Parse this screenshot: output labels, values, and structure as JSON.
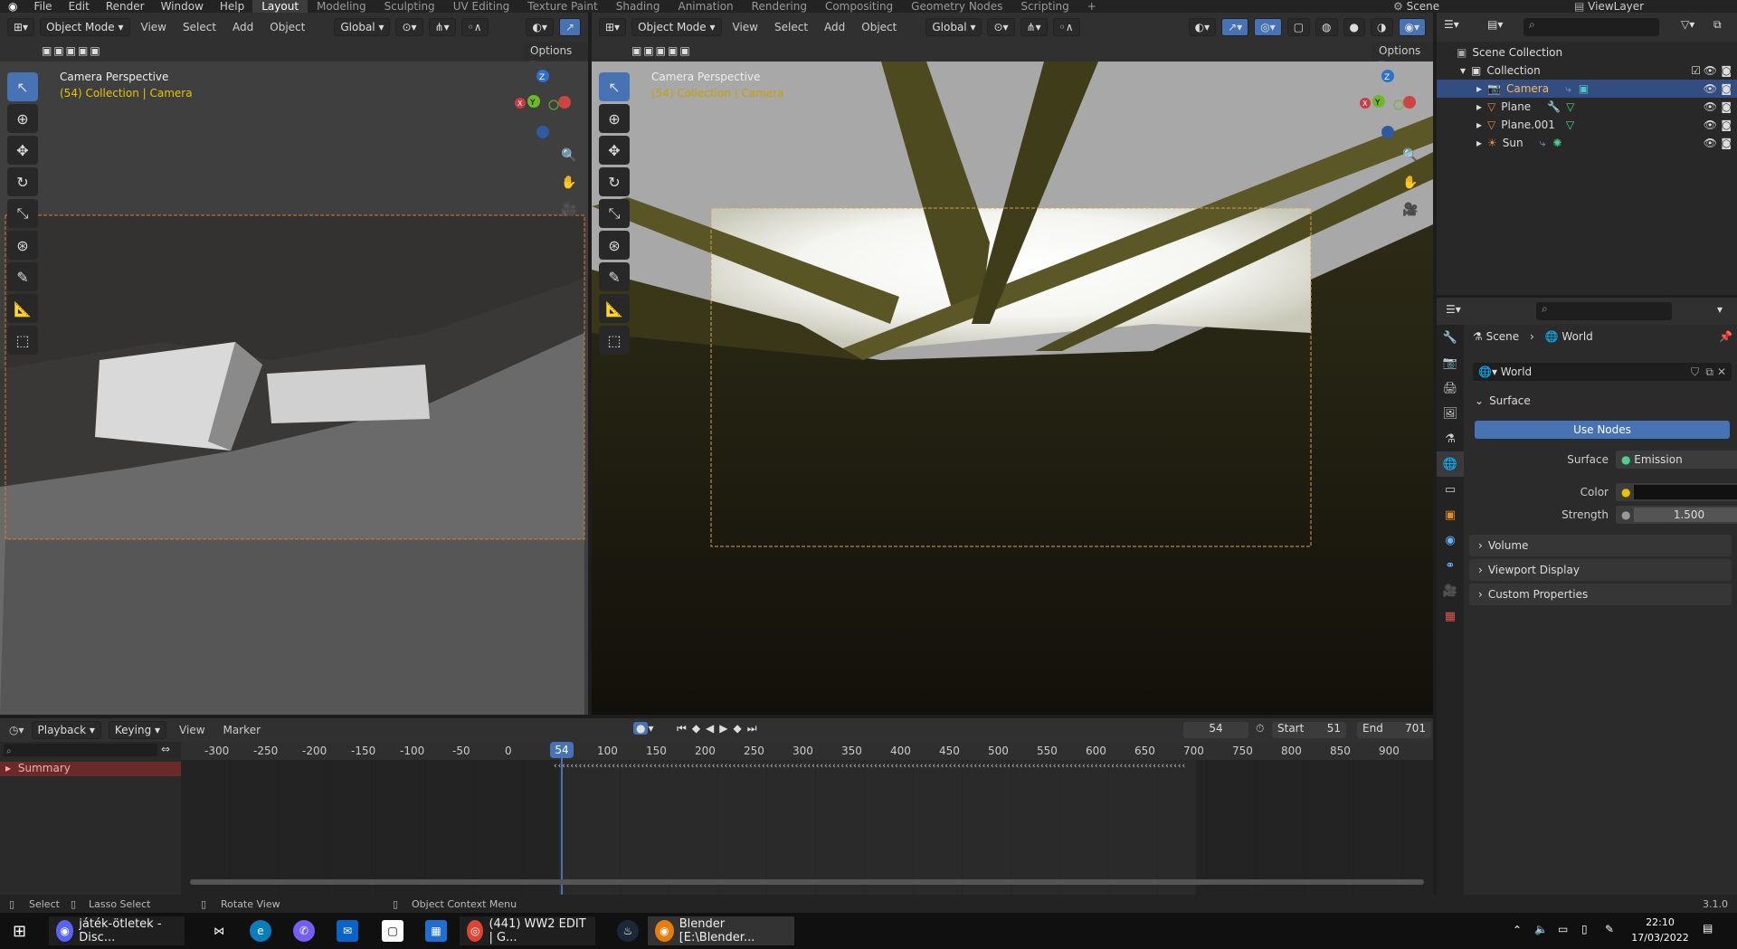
{
  "topbar": {
    "menus": [
      "File",
      "Edit",
      "Render",
      "Window",
      "Help"
    ],
    "workspaces": [
      "Layout",
      "Modeling",
      "Sculpting",
      "UV Editing",
      "Texture Paint",
      "Shading",
      "Animation",
      "Rendering",
      "Compositing",
      "Geometry Nodes",
      "Scripting"
    ],
    "add_workspace": "+",
    "scene": "Scene",
    "view_layer": "ViewLayer"
  },
  "viewport_left": {
    "mode": "Object Mode",
    "menus": [
      "View",
      "Select",
      "Add",
      "Object"
    ],
    "transform": "Global",
    "options": "Options",
    "title": "Camera Perspective",
    "subtitle": "(54) Collection | Camera"
  },
  "viewport_right": {
    "mode": "Object Mode",
    "menus": [
      "View",
      "Select",
      "Add",
      "Object"
    ],
    "transform": "Global",
    "options": "Options",
    "title": "Camera Perspective",
    "subtitle": "(54) Collection | Camera"
  },
  "gizmo": {
    "z": "Z",
    "y": "Y",
    "x": "X"
  },
  "outliner": {
    "root": "Scene Collection",
    "collection": "Collection",
    "items": [
      "Camera",
      "Plane",
      "Plane.001",
      "Sun"
    ]
  },
  "properties": {
    "breadcrumb_scene": "Scene",
    "breadcrumb_world": "World",
    "world_name": "World",
    "surface_panel": "Surface",
    "use_nodes": "Use Nodes",
    "surface_label": "Surface",
    "surface_value": "Emission",
    "color_label": "Color",
    "strength_label": "Strength",
    "strength_value": "1.500",
    "panels": [
      "Volume",
      "Viewport Display",
      "Custom Properties"
    ]
  },
  "timeline": {
    "menus": [
      "Playback",
      "Keying",
      "View",
      "Marker"
    ],
    "current_frame": "54",
    "start_label": "Start",
    "start": "51",
    "end_label": "End",
    "end": "701",
    "ruler": [
      "-300",
      "-250",
      "-200",
      "-150",
      "-100",
      "-50",
      "0",
      "100",
      "150",
      "200",
      "250",
      "300",
      "350",
      "400",
      "450",
      "500",
      "550",
      "600",
      "650",
      "700",
      "750",
      "800",
      "850",
      "900"
    ],
    "playhead": "54",
    "summary": "Summary"
  },
  "status": {
    "select": "Select",
    "lasso": "Lasso Select",
    "rotate": "Rotate View",
    "context": "Object Context Menu",
    "version": "3.1.0"
  },
  "taskbar": {
    "apps": [
      "játék-ötletek - Disc...",
      "(441) WW2 EDIT | G...",
      "Blender [E:\\Blender..."
    ],
    "time": "22:10",
    "date": "17/03/2022"
  },
  "colors": {
    "accent": "#4772b3",
    "selection": "#e8c300",
    "orange": "#e07a1f"
  }
}
